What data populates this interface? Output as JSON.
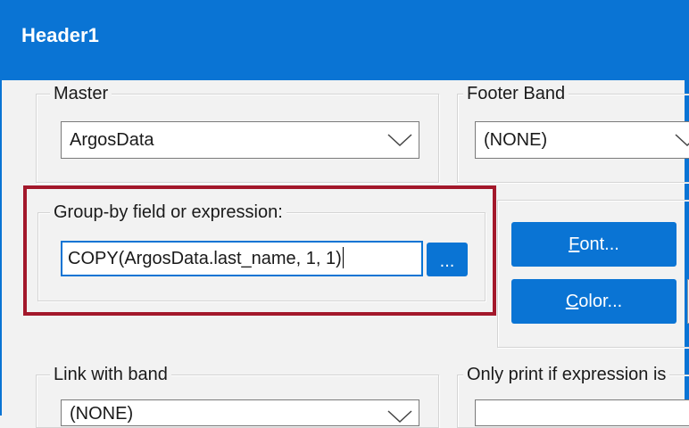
{
  "window": {
    "title": "Header1"
  },
  "master": {
    "label": "Master",
    "value": "ArgosData"
  },
  "footer_band": {
    "label": "Footer Band",
    "value": "(NONE)"
  },
  "group_by": {
    "label": "Group-by field or expression:",
    "value": "COPY(ArgosData.last_name, 1, 1)",
    "browse_label": "..."
  },
  "buttons": {
    "font": {
      "accel": "F",
      "rest": "ont..."
    },
    "color": {
      "accel": "C",
      "rest": "olor..."
    }
  },
  "link_with_band": {
    "label": "Link with band",
    "value": "(NONE)"
  },
  "only_print": {
    "label": "Only print if expression is"
  },
  "colors": {
    "accent": "#0a74d4",
    "highlight": "#a3182b",
    "background": "#f2f2f2"
  }
}
